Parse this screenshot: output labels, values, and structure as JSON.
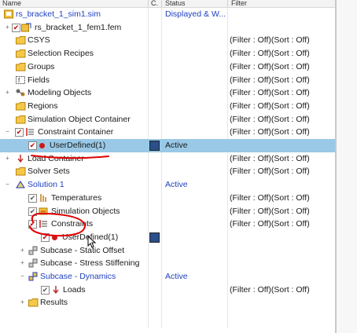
{
  "columns": {
    "name": "Name",
    "c": "C.",
    "status": "Status",
    "filter": "Filter"
  },
  "colors": {
    "selected": "#99c9e6",
    "annotation": "#e00000",
    "link_blue": "#1f3fbf"
  },
  "rows": [
    {
      "label": "rs_bracket_1_sim1.sim",
      "status": "Displayed & W...",
      "filter": "",
      "icon": "sim-file-icon",
      "blue": true
    },
    {
      "label": "rs_bracket_1_fem1.fem",
      "status": "",
      "filter": "",
      "icon": "fem-file-icon"
    },
    {
      "label": "CSYS",
      "status": "",
      "filter": "(Filter : Off)(Sort : Off)",
      "icon": "folder-icon"
    },
    {
      "label": "Selection Recipes",
      "status": "",
      "filter": "(Filter : Off)(Sort : Off)",
      "icon": "folder-icon"
    },
    {
      "label": "Groups",
      "status": "",
      "filter": "(Filter : Off)(Sort : Off)",
      "icon": "folder-icon"
    },
    {
      "label": "Fields",
      "status": "",
      "filter": "(Filter : Off)(Sort : Off)",
      "icon": "fields-icon"
    },
    {
      "label": "Modeling Objects",
      "status": "",
      "filter": "(Filter : Off)(Sort : Off)",
      "icon": "modeling-objects-icon"
    },
    {
      "label": "Regions",
      "status": "",
      "filter": "(Filter : Off)(Sort : Off)",
      "icon": "folder-icon"
    },
    {
      "label": "Simulation Object Container",
      "status": "",
      "filter": "(Filter : Off)(Sort : Off)",
      "icon": "folder-icon"
    },
    {
      "label": "Constraint Container",
      "status": "",
      "filter": "(Filter : Off)(Sort : Off)",
      "icon": "constraint-container-icon"
    },
    {
      "label": "UserDefined(1)",
      "status": "Active",
      "filter": "",
      "icon": "constraint-dot-icon"
    },
    {
      "label": "Load Container",
      "status": "",
      "filter": "(Filter : Off)(Sort : Off)",
      "icon": "load-container-icon"
    },
    {
      "label": "Solver Sets",
      "status": "",
      "filter": "(Filter : Off)(Sort : Off)",
      "icon": "folder-icon"
    },
    {
      "label": "Solution 1",
      "status": "Active",
      "filter": "",
      "icon": "solution-icon",
      "blue": true
    },
    {
      "label": "Temperatures",
      "status": "",
      "filter": "(Filter : Off)(Sort : Off)",
      "icon": "temperatures-icon"
    },
    {
      "label": "Simulation Objects",
      "status": "",
      "filter": "(Filter : Off)(Sort : Off)",
      "icon": "simulation-objects-icon"
    },
    {
      "label": "Constraints",
      "status": "",
      "filter": "(Filter : Off)(Sort : Off)",
      "icon": "constraints-icon"
    },
    {
      "label": "UserDefined(1)",
      "status": "",
      "filter": "",
      "icon": "constraint-dot-icon"
    },
    {
      "label": "Subcase - Static Offset",
      "status": "",
      "filter": "",
      "icon": "subcase-icon"
    },
    {
      "label": "Subcase - Stress Stiffening",
      "status": "",
      "filter": "",
      "icon": "subcase-icon"
    },
    {
      "label": "Subcase - Dynamics",
      "status": "Active",
      "filter": "",
      "icon": "subcase-icon",
      "blue": true
    },
    {
      "label": "Loads",
      "status": "",
      "filter": "(Filter : Off)(Sort : Off)",
      "icon": "loads-icon"
    },
    {
      "label": "Results",
      "status": "",
      "filter": "",
      "icon": "folder-icon"
    }
  ]
}
